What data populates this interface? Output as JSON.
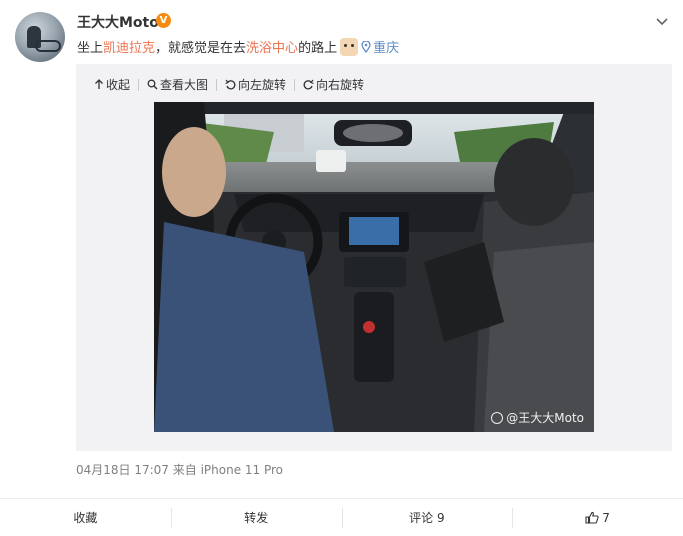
{
  "author": {
    "name": "王大大Moto",
    "verified_badge": "V",
    "avatar_icon": "avatar-motorcycle-rider"
  },
  "post": {
    "text_pre": "坐上",
    "link1": "凯迪拉克",
    "text_mid": "，就感觉是在去",
    "link2": "洗浴中心",
    "text_post": "的路上",
    "emoji": "doge-emoji",
    "location": "重庆"
  },
  "toolbar": {
    "collapse": "收起",
    "view_large": "查看大图",
    "rotate_left": "向左旋转",
    "rotate_right": "向右旋转"
  },
  "photo": {
    "watermark": "@王大大Moto"
  },
  "meta": {
    "date_source": "04月18日 17:07  来自 iPhone 11 Pro"
  },
  "actions": {
    "favorite": "收藏",
    "repost": "转发",
    "comment": "评论 9",
    "like_count": "7"
  },
  "colors": {
    "link": "#eb7350",
    "location": "#5d8dc6",
    "badge": "#f78b0f",
    "media_bg": "#f2f2f5"
  }
}
